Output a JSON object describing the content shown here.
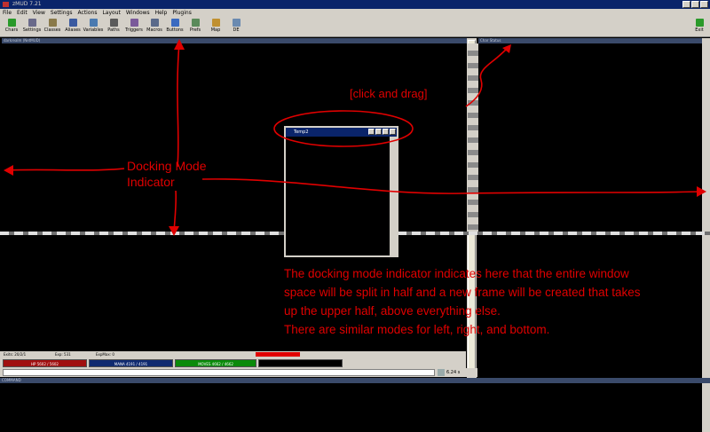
{
  "window": {
    "title": "zMUD 7.21"
  },
  "menu": [
    "File",
    "Edit",
    "View",
    "Settings",
    "Actions",
    "Layout",
    "Windows",
    "Help",
    "Plugins"
  ],
  "toolbar": {
    "buttons": [
      {
        "label": "Chars",
        "icon": "chars-icon"
      },
      {
        "label": "Settings",
        "icon": "settings-icon"
      },
      {
        "label": "Classes",
        "icon": "classes-icon"
      },
      {
        "label": "Aliases",
        "icon": "aliases-icon"
      },
      {
        "label": "Variables",
        "icon": "variables-icon"
      },
      {
        "label": "Paths",
        "icon": "paths-icon"
      },
      {
        "label": "Triggers",
        "icon": "triggers-icon"
      },
      {
        "label": "Macros",
        "icon": "macros-icon"
      },
      {
        "label": "Buttons",
        "icon": "buttons-icon"
      },
      {
        "label": "Prefs",
        "icon": "prefs-icon"
      },
      {
        "label": "Map",
        "icon": "map-icon"
      },
      {
        "label": "DE",
        "icon": "de-icon"
      }
    ],
    "exit_label": "Exit"
  },
  "panes": {
    "main_title": "darkrealm (NetMUD)",
    "right_title": "Char Status",
    "command_title": "COMMAND"
  },
  "floating_window": {
    "title": "Temp2"
  },
  "status": {
    "line": [
      "Exits: 20/2/1",
      "Exp: 531",
      "ExpMax: 0"
    ],
    "hp": "HP 5602 / 5602",
    "mana": "MANA 4191 / 4191",
    "moves": "MOVES 4662 / 4662",
    "speed": "6.24 s"
  },
  "annotations": {
    "click_drag": "[click and drag]",
    "indicator": "Docking Mode Indicator",
    "explanation": [
      "The docking mode indicator indicates here that the entire window",
      "space will be split in half and a new frame will be created that takes",
      "up the upper half, above everything else.",
      "There are similar modes for left, right, and bottom."
    ]
  },
  "colors": {
    "annotation": "#e00000",
    "hp_bar": "#a01010",
    "mana_bar": "#102a70",
    "moves_bar": "#0a8a0a"
  }
}
